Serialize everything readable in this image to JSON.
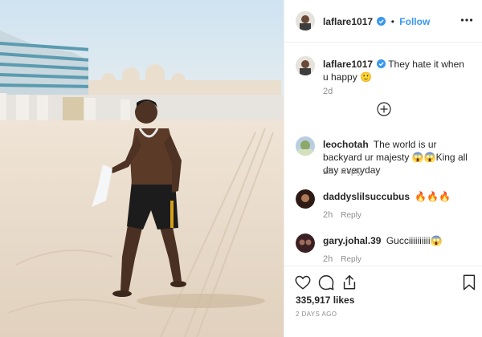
{
  "post": {
    "author": "laflare1017",
    "follow_label": "Follow",
    "separator": "•",
    "caption": "They hate it when u happy 🙂",
    "caption_time": "2d"
  },
  "comments": [
    {
      "user": "leochotah",
      "text": "The world is ur backyard ur majesty 😱😱King all day everyday",
      "time": "2h",
      "reply_label": "Reply"
    },
    {
      "user": "daddyslilsuccubus",
      "text": "🔥🔥🔥",
      "time": "2h",
      "reply_label": "Reply"
    },
    {
      "user": "gary.johal.39",
      "text": "Gucciiiiiiiiii😱",
      "time": "2h",
      "reply_label": "Reply"
    }
  ],
  "stats": {
    "likes": "335,917 likes",
    "date": "2 DAYS AGO"
  },
  "icons": {
    "verified": "verified-badge-icon",
    "more": "more-options-icon",
    "load_more": "load-more-comments-icon",
    "like": "heart-icon",
    "comment": "comment-icon",
    "share": "share-icon",
    "save": "bookmark-icon"
  },
  "colors": {
    "link": "#3897f0",
    "verified": "#3897f0",
    "muted": "#8e8e8e",
    "text": "#262626",
    "border": "#efefef"
  }
}
